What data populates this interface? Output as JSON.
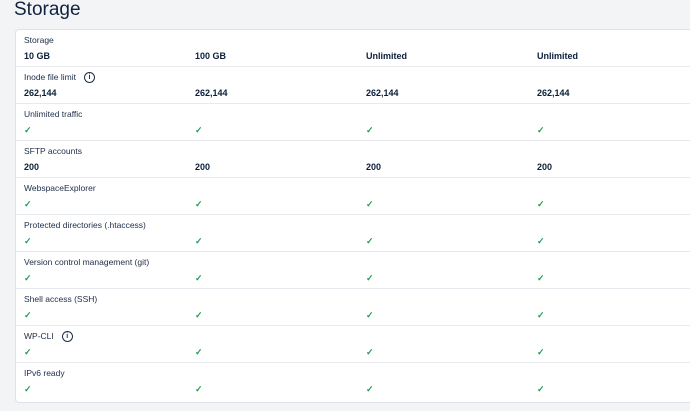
{
  "section_title": "Storage",
  "icons": {
    "check": "check-icon",
    "info": "info-icon"
  },
  "colors": {
    "check": "#1f9d55",
    "text": "#0b1f3a"
  },
  "rows": [
    {
      "label": "Storage",
      "values": [
        "10 GB",
        "100 GB",
        "Unlimited",
        "Unlimited"
      ]
    },
    {
      "label": "Inode file limit",
      "info": "i",
      "values": [
        "262,144",
        "262,144",
        "262,144",
        "262,144"
      ]
    },
    {
      "label": "Unlimited traffic",
      "check": "✓"
    },
    {
      "label": "SFTP accounts",
      "values": [
        "200",
        "200",
        "200",
        "200"
      ]
    },
    {
      "label": "WebspaceExplorer",
      "check": "✓"
    },
    {
      "label": "Protected directories (.htaccess)",
      "check": "✓"
    },
    {
      "label": "Version control management (git)",
      "check": "✓"
    },
    {
      "label": "Shell access (SSH)",
      "check": "✓"
    },
    {
      "label": "WP-CLI",
      "info": "i",
      "check": "✓"
    },
    {
      "label": "IPv6 ready",
      "check": "✓"
    }
  ]
}
